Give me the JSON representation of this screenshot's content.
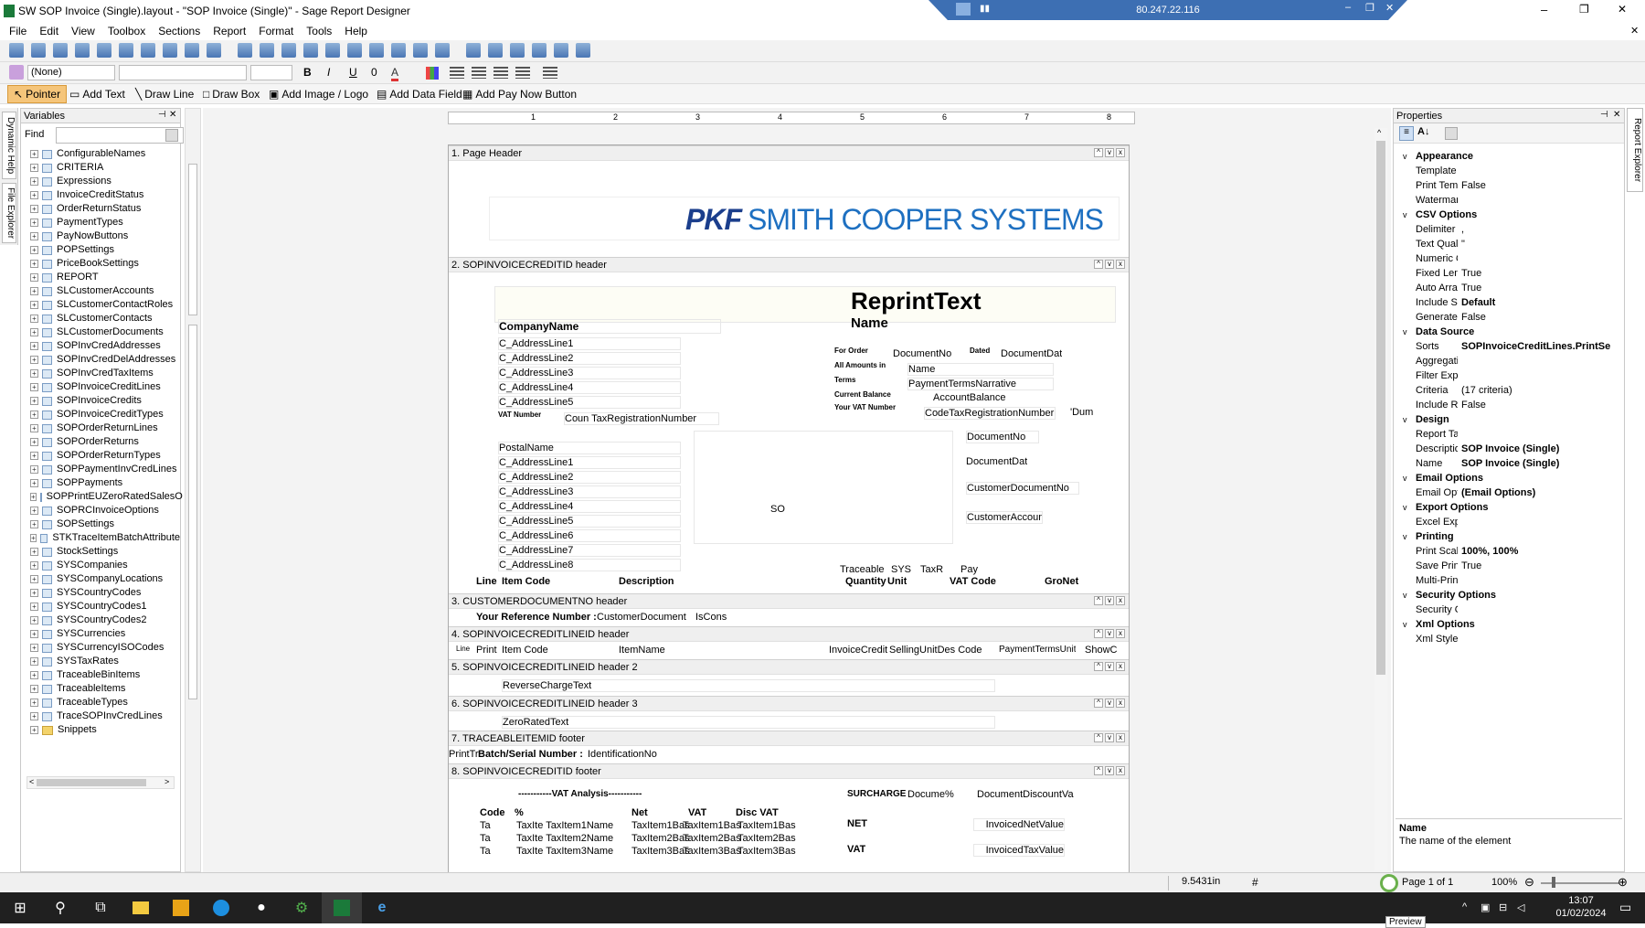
{
  "window": {
    "title": "SW SOP Invoice (Single).layout - \"SOP Invoice (Single)\" - Sage Report Designer",
    "rdp_ip": "80.247.22.116"
  },
  "menu": [
    "File",
    "Edit",
    "View",
    "Toolbox",
    "Sections",
    "Report",
    "Format",
    "Tools",
    "Help"
  ],
  "format_toolbar": {
    "style_value": "(None)"
  },
  "toolbox": {
    "pointer": "Pointer",
    "add_text": "Add Text",
    "draw_line": "Draw Line",
    "draw_box": "Draw Box",
    "add_image": "Add Image / Logo",
    "add_data_field": "Add Data Field",
    "add_pay_now": "Add Pay Now Button"
  },
  "left_tabs": [
    "Dynamic Help",
    "File Explorer"
  ],
  "variables": {
    "title": "Variables",
    "find_label": "Find",
    "items": [
      "ConfigurableNames",
      "CRITERIA",
      "Expressions",
      "InvoiceCreditStatus",
      "OrderReturnStatus",
      "PaymentTypes",
      "PayNowButtons",
      "POPSettings",
      "PriceBookSettings",
      "REPORT",
      "SLCustomerAccounts",
      "SLCustomerContactRoles",
      "SLCustomerContacts",
      "SLCustomerDocuments",
      "SOPInvCredAddresses",
      "SOPInvCredDelAddresses",
      "SOPInvCredTaxItems",
      "SOPInvoiceCreditLines",
      "SOPInvoiceCredits",
      "SOPInvoiceCreditTypes",
      "SOPOrderReturnLines",
      "SOPOrderReturns",
      "SOPOrderReturnTypes",
      "SOPPaymentInvCredLines",
      "SOPPayments",
      "SOPPrintEUZeroRatedSalesO",
      "SOPRCInvoiceOptions",
      "SOPSettings",
      "STKTraceItemBatchAttribute",
      "StockSettings",
      "SYSCompanies",
      "SYSCompanyLocations",
      "SYSCountryCodes",
      "SYSCountryCodes1",
      "SYSCountryCodes2",
      "SYSCurrencies",
      "SYSCurrencyISOCodes",
      "SYSTaxRates",
      "TraceableBinItems",
      "TraceableItems",
      "TraceableTypes",
      "TraceSOPInvCredLines"
    ],
    "folder": "Snippets"
  },
  "ruler": [
    "1",
    "2",
    "3",
    "4",
    "5",
    "6",
    "7",
    "8"
  ],
  "bands": {
    "b1": "1. Page Header",
    "b2": "2. SOPINVOICECREDITID header",
    "b3": "3. CUSTOMERDOCUMENTNO header",
    "b4": "4. SOPINVOICECREDITLINEID header",
    "b5": "5. SOPINVOICECREDITLINEID header 2",
    "b6": "6. SOPINVOICECREDITLINEID header 3",
    "b7": "7. TRACEABLEITEMID footer",
    "b8": "8. SOPINVOICECREDITID footer"
  },
  "logo": {
    "part1": "PKF",
    "part2": "SMITH COOPER SYSTEMS"
  },
  "fields": {
    "reprint": "ReprintText",
    "name": "Name",
    "company": "CompanyName",
    "c1": "C_AddressLine1",
    "c2": "C_AddressLine2",
    "c3": "C_AddressLine3",
    "c4": "C_AddressLine4",
    "c5": "C_AddressLine5",
    "vat_label": "VAT Number",
    "vat_field": "Coun TaxRegistrationNumber",
    "for_order": "For Order",
    "doc_no": "DocumentNo",
    "dated": "Dated",
    "doc_date": "DocumentDat",
    "all_amounts": "All Amounts in",
    "name2": "Name",
    "terms": "Terms",
    "terms_field": "PaymentTermsNarrative",
    "cur_bal": "Current Balance",
    "acc_bal": "AccountBalance",
    "your_vat": "Your VAT Number",
    "code_tax": "CodeTaxRegistrationNumber",
    "dum": "'Dum",
    "postal": "PostalName",
    "p1": "C_AddressLine1",
    "p2": "C_AddressLine2",
    "p3": "C_AddressLine3",
    "p4": "C_AddressLine4",
    "p5": "C_AddressLine5",
    "p6": "C_AddressLine6",
    "p7": "C_AddressLine7",
    "p8": "C_AddressLine8",
    "so": "SO",
    "doc_no2": "DocumentNo",
    "doc_date2": "DocumentDat",
    "cust_doc": "CustomerDocumentNo",
    "cust_acc": "CustomerAccount",
    "traceable": "Traceable",
    "sys": "SYS",
    "taxr": "TaxR",
    "pay": "Pay",
    "h_line": "Line",
    "h_item": "Item Code",
    "h_desc": "Description",
    "h_qty": "Quantity",
    "h_unit": "Unit",
    "h_vat": "VAT Code",
    "h_gross": "GroNet",
    "your_ref": "Your Reference Number :",
    "cust_doc3": "CustomerDocument",
    "iscons": "IsCons",
    "l_line": "Line",
    "l_print": "Print",
    "l_item": "Item Code",
    "l_name": "ItemName",
    "l_inv": "InvoiceCredit",
    "l_sell": "SellingUnitDes Code",
    "l_pay": "PaymentTermsUnit",
    "l_show": "ShowC",
    "reverse": "ReverseChargeText",
    "zero": "ZeroRatedText",
    "printtr": "PrintTr",
    "batch": "Batch/Serial Number :",
    "ident": "IdentificationNo",
    "vat_analysis": "-----------VAT Analysis-----------",
    "surcharge": "SURCHARGE",
    "docume": "Docume%",
    "doc_disc": "DocumentDiscountVa",
    "va_code": "Code",
    "va_pct": "%",
    "va_net": "Net",
    "va_vat": "VAT",
    "va_disc": "Disc VAT",
    "net": "NET",
    "inv_net": "InvoicedNetValue",
    "vat": "VAT",
    "inv_tax": "InvoicedTaxValue"
  },
  "vat_rows": [
    [
      "Ta",
      "TaxIte TaxItem1Name",
      "TaxItem1Bas",
      "TaxItem1Bas",
      "TaxItem1Bas"
    ],
    [
      "Ta",
      "TaxIte TaxItem2Name",
      "TaxItem2Bas",
      "TaxItem2Bas",
      "TaxItem2Bas"
    ],
    [
      "Ta",
      "TaxIte TaxItem3Name",
      "TaxItem3Bas",
      "TaxItem3Bas",
      "TaxItem3Bas"
    ]
  ],
  "properties": {
    "title": "Properties",
    "cats": [
      {
        "name": "Appearance",
        "rows": [
          [
            "Template",
            ""
          ],
          [
            "Print Template",
            "False"
          ],
          [
            "Watermark",
            ""
          ]
        ]
      },
      {
        "name": "CSV Options",
        "rows": [
          [
            "Delimiter",
            ","
          ],
          [
            "Text Qualifier",
            "\""
          ],
          [
            "Numeric Qualif",
            ""
          ],
          [
            "Fixed Length",
            "True"
          ],
          [
            "Auto Arrange",
            "True"
          ],
          [
            "Include Sectio",
            "Default"
          ],
          [
            "Generate Hea",
            "False"
          ]
        ]
      },
      {
        "name": "Data Source",
        "rows": [
          [
            "Sorts",
            "SOPInvoiceCreditLines.PrintSe"
          ],
          [
            "Aggregation",
            ""
          ],
          [
            "Filter Expressi",
            ""
          ],
          [
            "Criteria",
            "(17 criteria)"
          ],
          [
            "Include Recor",
            "False"
          ]
        ]
      },
      {
        "name": "Design",
        "rows": [
          [
            "Report Tags",
            ""
          ],
          [
            "Description",
            "SOP Invoice (Single)"
          ],
          [
            "Name",
            "SOP Invoice (Single)"
          ]
        ]
      },
      {
        "name": "Email Options",
        "rows": [
          [
            "Email Options",
            "(Email Options)"
          ]
        ]
      },
      {
        "name": "Export Options",
        "rows": [
          [
            "Excel Export C",
            ""
          ]
        ]
      },
      {
        "name": "Printing",
        "rows": [
          [
            "Print Scaling",
            "100%, 100%"
          ],
          [
            "Save Printer S",
            "True"
          ],
          [
            "Multi-Printer S",
            ""
          ]
        ]
      },
      {
        "name": "Security Options",
        "rows": [
          [
            "Security Optio",
            ""
          ]
        ]
      },
      {
        "name": "Xml Options",
        "rows": [
          [
            "Xml Style Shee",
            ""
          ]
        ]
      }
    ],
    "desc_title": "Name",
    "desc_text": "The name of the element"
  },
  "right_tab": "Report Explorer",
  "status": {
    "position": "9.5431in",
    "page": "Page 1 of 1",
    "zoom": "100%",
    "tooltip": "Preview"
  },
  "taskbar": {
    "time": "13:07",
    "date": "01/02/2024"
  }
}
